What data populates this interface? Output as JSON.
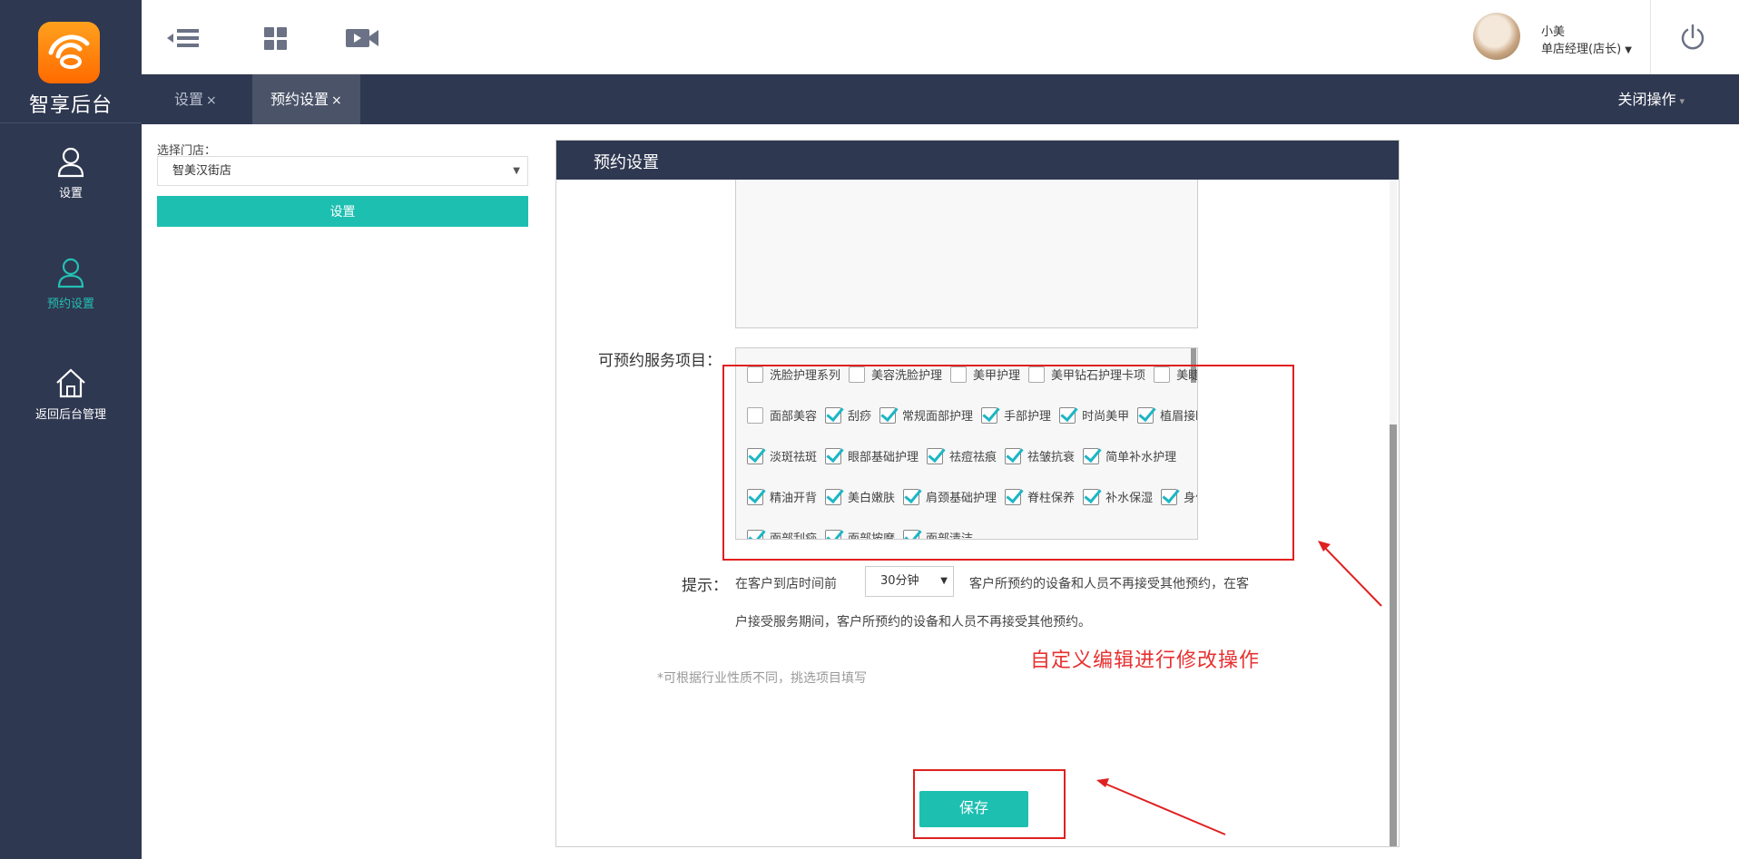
{
  "app": {
    "logo_text": "智享后台",
    "logo_icon": "wifi-logo-icon"
  },
  "sidebar": {
    "items": [
      {
        "label": "设置",
        "icon": "user-icon",
        "active": false
      },
      {
        "label": "预约设置",
        "icon": "user-icon",
        "active": true
      },
      {
        "label": "返回后台管理",
        "icon": "home-icon",
        "active": false
      }
    ]
  },
  "topbar": {
    "icons": [
      "menu-collapse-icon",
      "grid-icon",
      "video-icon"
    ],
    "user": {
      "name": "小美",
      "role": "单店经理(店长)"
    },
    "power_icon": "power-icon"
  },
  "tabs": {
    "items": [
      {
        "label": "设置",
        "close": "×",
        "active": false
      },
      {
        "label": "预约设置",
        "close": "×",
        "active": true
      }
    ],
    "close_ops": "关闭操作"
  },
  "store": {
    "label": "选择门店：",
    "selected": "智美汉街店",
    "button": "设置"
  },
  "panel": {
    "title": "预约设置",
    "services_label": "可预约服务项目：",
    "services": [
      [
        {
          "name": "洗脸护理系列",
          "checked": false
        },
        {
          "name": "美容洗脸护理",
          "checked": false
        },
        {
          "name": "美甲护理",
          "checked": false
        },
        {
          "name": "美甲钻石护理卡项",
          "checked": false
        },
        {
          "name": "美睫",
          "checked": false
        }
      ],
      [
        {
          "name": "面部美容",
          "checked": false
        },
        {
          "name": "刮痧",
          "checked": true
        },
        {
          "name": "常规面部护理",
          "checked": true
        },
        {
          "name": "手部护理",
          "checked": true
        },
        {
          "name": "时尚美甲",
          "checked": true
        },
        {
          "name": "植眉接睫毛",
          "checked": true
        }
      ],
      [
        {
          "name": "淡斑祛斑",
          "checked": true
        },
        {
          "name": "眼部基础护理",
          "checked": true
        },
        {
          "name": "祛痘祛痕",
          "checked": true
        },
        {
          "name": "祛皱抗衰",
          "checked": true
        },
        {
          "name": "简单补水护理",
          "checked": true
        }
      ],
      [
        {
          "name": "精油开背",
          "checked": true
        },
        {
          "name": "美白嫩肤",
          "checked": true
        },
        {
          "name": "肩颈基础护理",
          "checked": true
        },
        {
          "name": "脊柱保养",
          "checked": true
        },
        {
          "name": "补水保湿",
          "checked": true
        },
        {
          "name": "身体脱毛",
          "checked": true
        }
      ],
      [
        {
          "name": "面部刮痧",
          "checked": true
        },
        {
          "name": "面部按摩",
          "checked": true
        },
        {
          "name": "面部清洁",
          "checked": true
        }
      ]
    ],
    "tip_label": "提示：",
    "tip_before": "在客户到店时间前",
    "tip_select": "30分钟",
    "tip_after_line1": "客户所预约的设备和人员不再接受其他预约，在客",
    "tip_after_line2": "户接受服务期间，客户所预约的设备和人员不再接受其他预约。",
    "hint": "*可根据行业性质不同，挑选项目填写",
    "save_button": "保存"
  },
  "annotation": {
    "text": "自定义编辑进行修改操作",
    "color": "#e83030"
  },
  "colors": {
    "sidebar": "#2f3851",
    "accent": "#1dbfb1",
    "active_nav": "#23c0b3",
    "logo": "#ff8a00"
  }
}
